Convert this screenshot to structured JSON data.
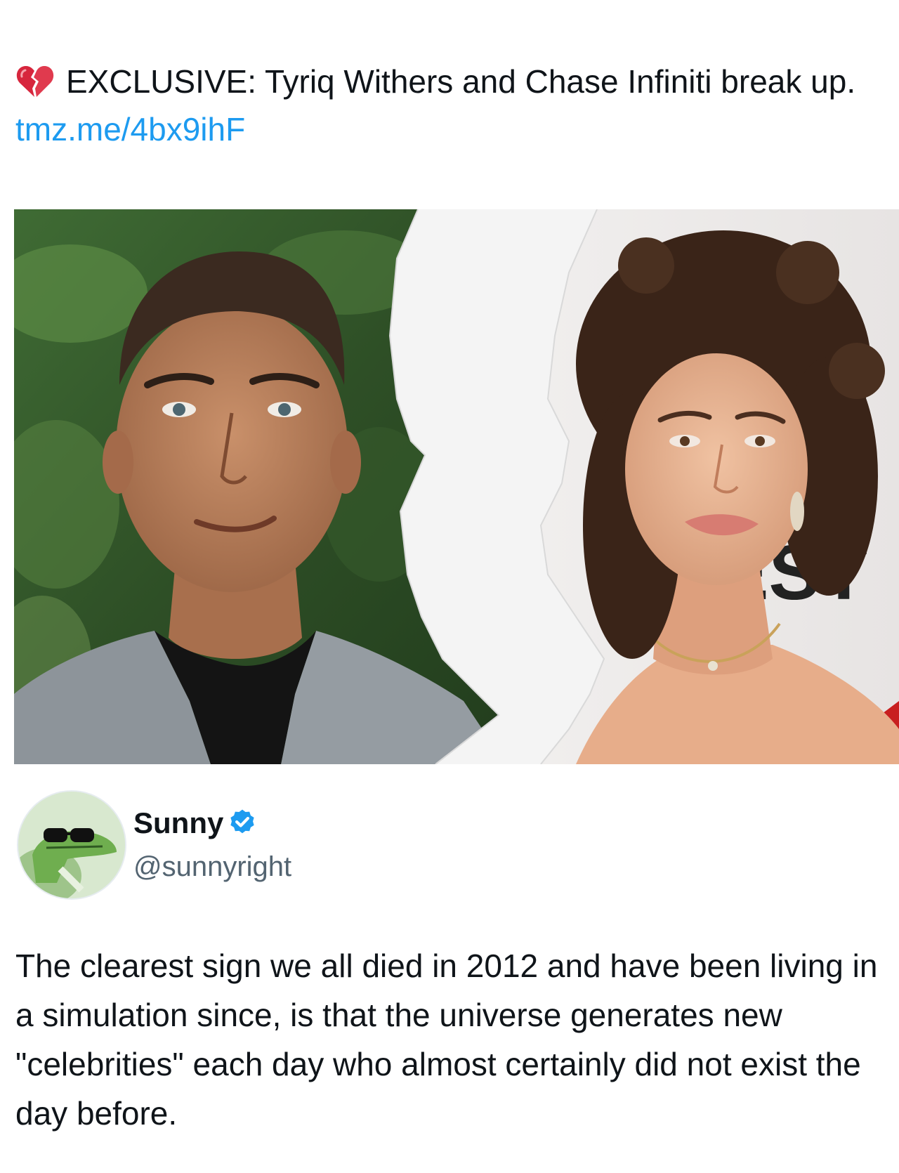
{
  "quoted_tweet": {
    "emoji_icon": "broken-heart-icon",
    "text": "EXCLUSIVE: Tyriq Withers and Chase Infiniti break up.",
    "link": "tmz.me/4bx9ihF",
    "link_color": "#1d9bf0"
  },
  "media": {
    "sign_text": "EST"
  },
  "author": {
    "name": "Sunny",
    "handle": "@sunnyright",
    "verified_icon": "verified-badge-icon",
    "verified_color": "#1d9bf0"
  },
  "post": {
    "text": "The clearest sign we all died in 2012 and have been living in a simulation since, is that the universe generates new \"celebrities\" each day who almost certainly did not exist the day before."
  }
}
